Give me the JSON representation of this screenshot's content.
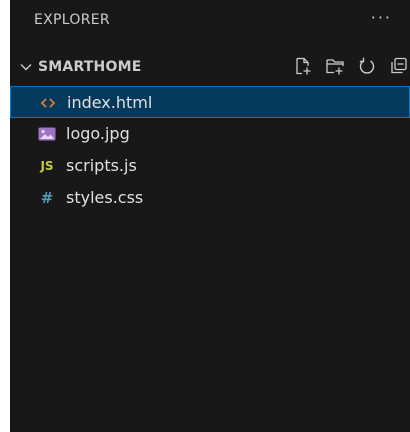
{
  "explorer": {
    "title": "EXPLORER",
    "more_actions_label": "···"
  },
  "section": {
    "title": "SMARTHOME",
    "expanded": true
  },
  "files": [
    {
      "name": "index.html",
      "icon": "html-file-icon",
      "selected": true
    },
    {
      "name": "logo.jpg",
      "icon": "image-file-icon",
      "selected": false
    },
    {
      "name": "scripts.js",
      "icon": "js-file-icon",
      "icon_text": "JS",
      "selected": false
    },
    {
      "name": "styles.css",
      "icon": "css-file-icon",
      "icon_text": "#",
      "selected": false
    }
  ],
  "colors": {
    "panel_bg": "#181818",
    "selected_bg": "#04395e",
    "selected_border": "#0078d4",
    "html_icon": "#e37933",
    "image_icon": "#a074c4",
    "js_icon": "#cbcb41",
    "css_icon": "#519aba"
  }
}
